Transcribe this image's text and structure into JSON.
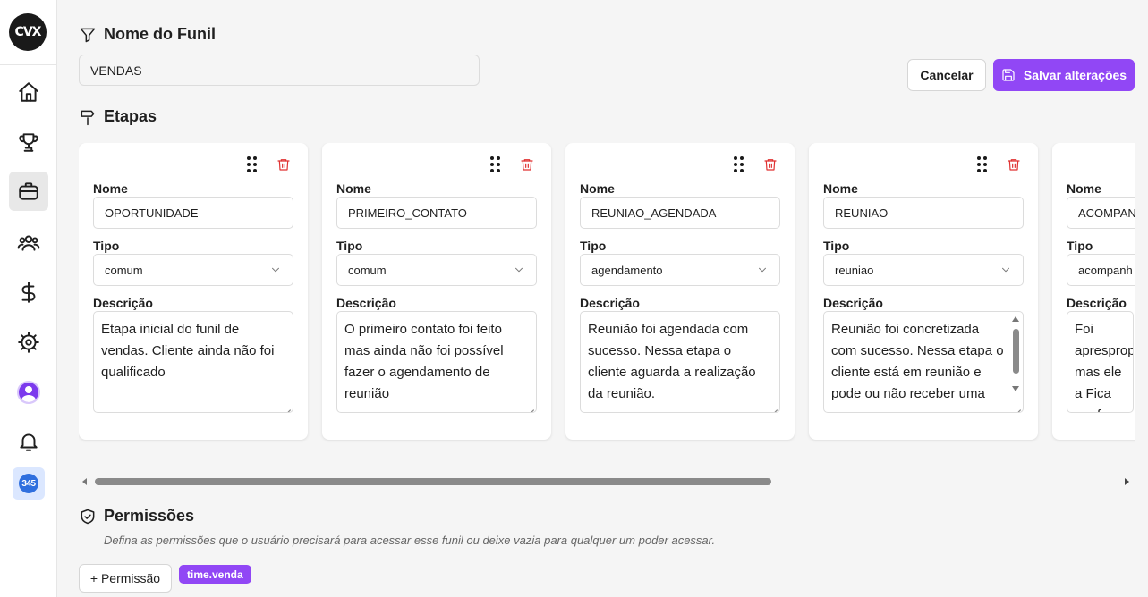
{
  "app": {
    "logo_text": "CVX"
  },
  "sidebar": {
    "items": [
      {
        "name": "home",
        "icon": "home-icon"
      },
      {
        "name": "trophy",
        "icon": "trophy-icon"
      },
      {
        "name": "briefcase",
        "icon": "briefcase-icon",
        "active": true
      },
      {
        "name": "users",
        "icon": "users-icon"
      },
      {
        "name": "finance",
        "icon": "dollar-icon"
      },
      {
        "name": "settings",
        "icon": "gear-icon"
      },
      {
        "name": "profile",
        "icon": "avatar-icon"
      },
      {
        "name": "notifications",
        "icon": "bell-icon"
      },
      {
        "name": "app-badge",
        "icon": "badge-icon",
        "badge_text": "345"
      }
    ]
  },
  "funnel": {
    "title": "Nome do Funil",
    "name_value": "VENDAS"
  },
  "actions": {
    "cancel_label": "Cancelar",
    "save_label": "Salvar alterações"
  },
  "stages": {
    "title": "Etapas",
    "labels": {
      "name": "Nome",
      "type": "Tipo",
      "description": "Descrição"
    },
    "items": [
      {
        "name": "OPORTUNIDADE",
        "type": "comum",
        "description": "Etapa inicial do funil de vendas. Cliente ainda não foi qualificado"
      },
      {
        "name": "PRIMEIRO_CONTATO",
        "type": "comum",
        "description": "O primeiro contato foi feito mas ainda não foi possível fazer o agendamento de reunião"
      },
      {
        "name": "REUNIAO_AGENDADA",
        "type": "agendamento",
        "description": "Reunião foi agendada com sucesso. Nessa etapa o cliente aguarda a realização da reunião."
      },
      {
        "name": "REUNIAO",
        "type": "reuniao",
        "description": "Reunião foi concretizada com sucesso. Nessa etapa o cliente está em reunião e pode ou não receber uma"
      },
      {
        "name": "ACOMPAN",
        "type": "acompanh",
        "description": "Foi apresproposta mas ele a Fica em fo"
      }
    ]
  },
  "permissions": {
    "title": "Permissões",
    "description": "Defina as permissões que o usuário precisará para acessar esse funil ou deixe vazia para qualquer um poder acessar.",
    "add_label": "+ Permissão",
    "tags": [
      "time.venda"
    ]
  },
  "colors": {
    "accent": "#9147f5",
    "danger": "#e03131",
    "background": "#f5f5f5"
  }
}
